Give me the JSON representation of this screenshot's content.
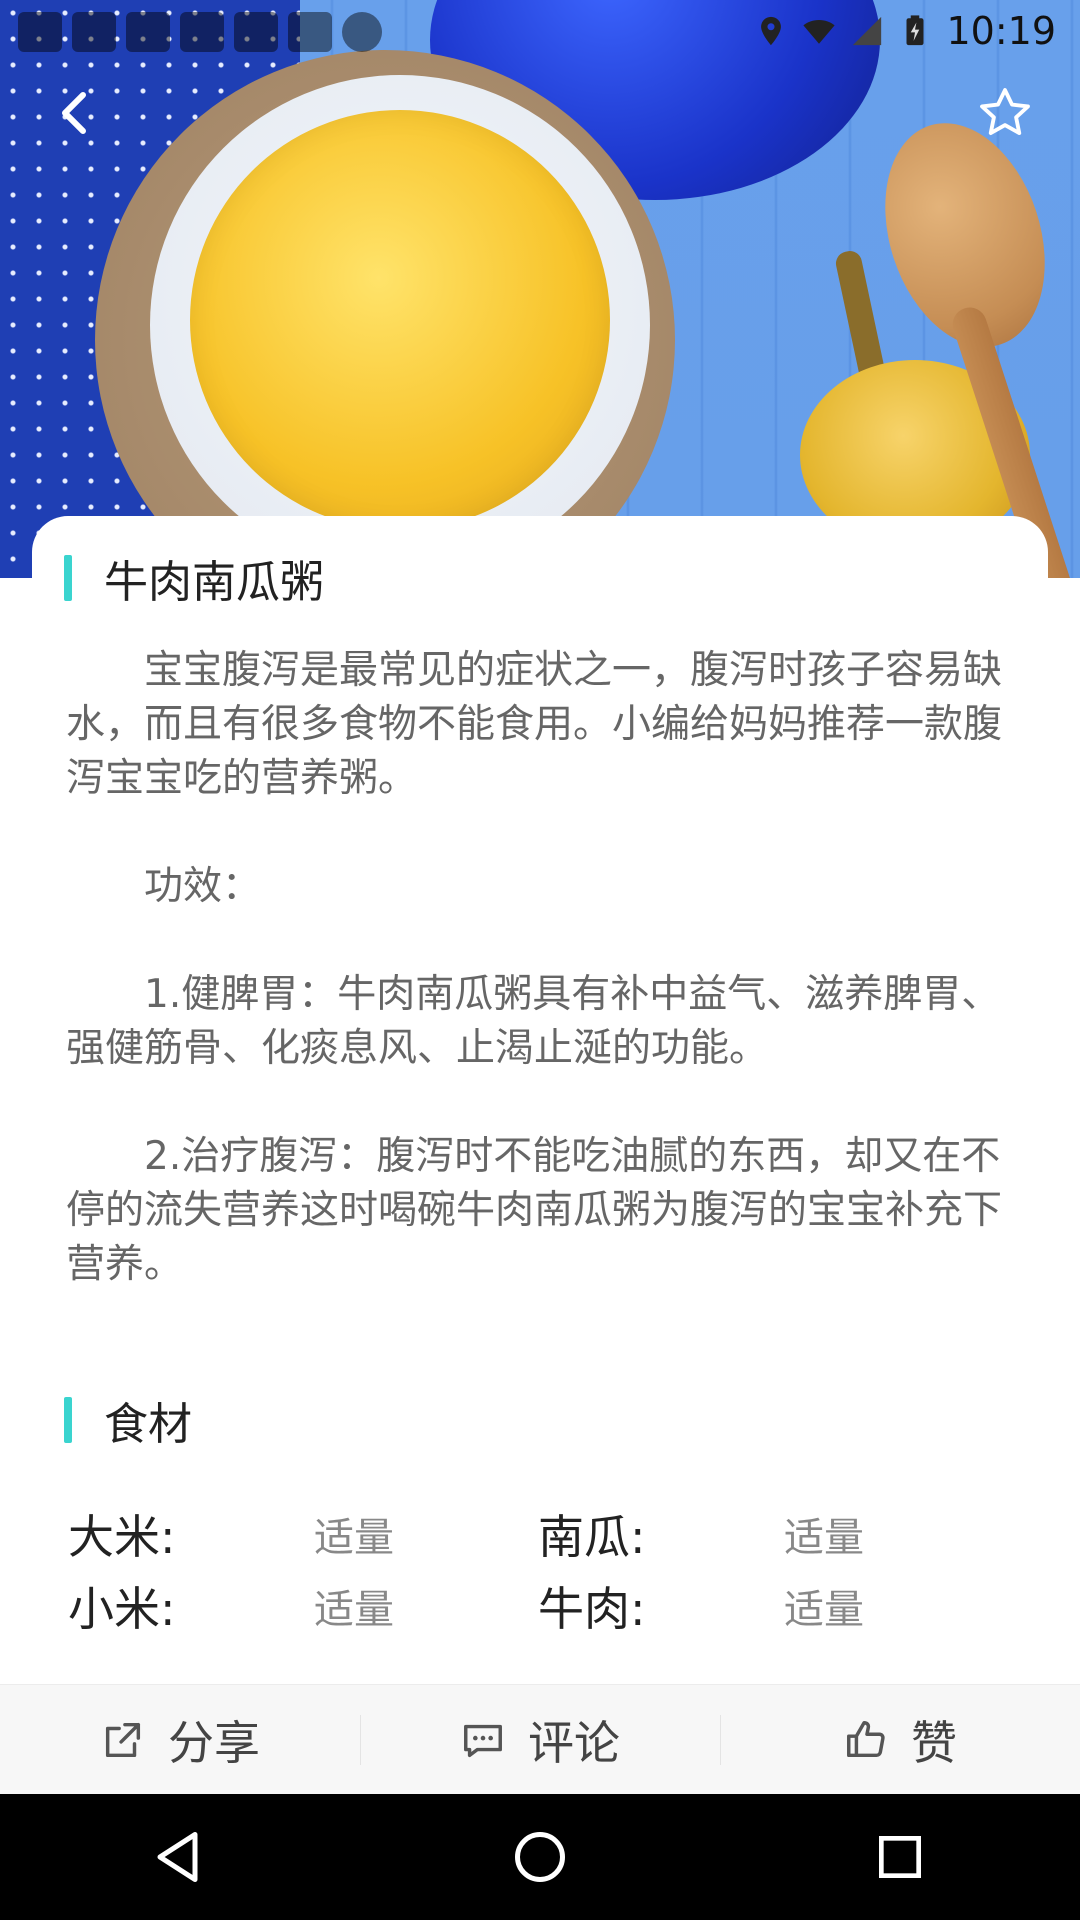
{
  "status_bar": {
    "time": "10:19"
  },
  "recipe": {
    "title": "牛肉南瓜粥",
    "description": "　　宝宝腹泻是最常见的症状之一，腹泻时孩子容易缺水，而且有很多食物不能食用。小编给妈妈推荐一款腹泻宝宝吃的营养粥。\n\n　　功效：\n\n　　1.健脾胃：牛肉南瓜粥具有补中益气、滋养脾胃、强健筋骨、化痰息风、止渴止涎的功能。\n\n　　2.治疗腹泻：腹泻时不能吃油腻的东西，却又在不停的流失营养这时喝碗牛肉南瓜粥为腹泻的宝宝补充下营养。"
  },
  "ingredients": {
    "title": "食材",
    "items": [
      {
        "name": "大米:",
        "qty": "适量"
      },
      {
        "name": "南瓜:",
        "qty": "适量"
      },
      {
        "name": "小米:",
        "qty": "适量"
      },
      {
        "name": "牛肉:",
        "qty": "适量"
      }
    ]
  },
  "actions": {
    "share": "分享",
    "comment": "评论",
    "like": "赞"
  },
  "icons": {
    "back": "back-arrow-icon",
    "favorite": "star-icon",
    "share": "share-icon",
    "comment": "comment-icon",
    "like": "thumbs-up-icon",
    "nav_back": "triangle-back-icon",
    "nav_home": "circle-home-icon",
    "nav_recent": "square-recent-icon"
  },
  "colors": {
    "accent": "#3ad4cf",
    "text_primary": "#222222",
    "text_secondary": "#666666",
    "action_bar_bg": "#f7f7f7"
  }
}
